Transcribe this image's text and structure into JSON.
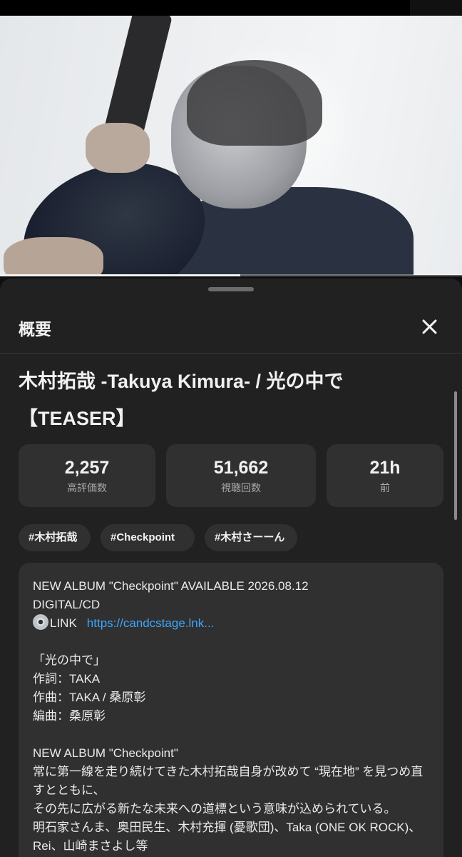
{
  "video": {
    "progress_percent": 52
  },
  "sheet": {
    "title": "概要"
  },
  "title": {
    "line1": "木村拓哉 -Takuya Kimura- / 光の中で",
    "line2": "【TEASER】"
  },
  "stats": [
    {
      "value": "2,257",
      "label": "高評価数"
    },
    {
      "value": "51,662",
      "label": "視聴回数"
    },
    {
      "value": "21h",
      "label": "前"
    }
  ],
  "tags": [
    "#木村拓哉",
    "#Checkpoint",
    "#木村さーーん"
  ],
  "description": {
    "line1": "NEW ALBUM \"Checkpoint\" AVAILABLE 2026.08.12",
    "line2": "DIGITAL/CD",
    "link_label": "LINK",
    "link_url": "https://candcstage.lnk...",
    "song_title": "「光の中で」",
    "lyrics": "作詞：TAKA",
    "composer": "作曲：TAKA / 桑原彰",
    "arranger": "編曲：桑原彰",
    "album_heading": "NEW ALBUM \"Checkpoint\"",
    "body1": "常に第一線を走り続けてきた木村拓哉自身が改めて “現在地” を見つめ直すとともに、",
    "body2": "その先に広がる新たな未来への道標という意味が込められている。",
    "body3": "明石家さんま、奥田民生、木村充揮 (憂歌団)、Taka (ONE OK ROCK)、Rei、山崎まさよし等"
  }
}
